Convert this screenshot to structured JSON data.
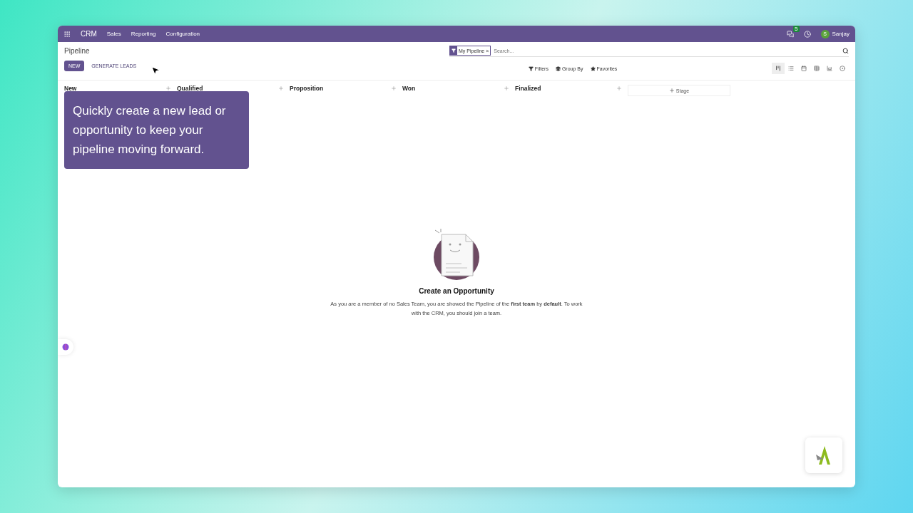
{
  "navbar": {
    "app": "CRM",
    "menus": [
      "Sales",
      "Reporting",
      "Configuration"
    ],
    "messages_badge": "5",
    "user_initial": "S",
    "user_name": "Sanjay"
  },
  "breadcrumb": "Pipeline",
  "buttons": [
    {
      "label": "NEW",
      "kind": "primary"
    },
    {
      "label": "GENERATE LEADS",
      "kind": "link"
    }
  ],
  "search": {
    "facet": "My Pipeline",
    "facet_remove": "×",
    "placeholder": "Search..."
  },
  "search_options": [
    "Filters",
    "Group By",
    "Favorites"
  ],
  "views": [
    {
      "kind": "kanban",
      "selected": true
    },
    {
      "kind": "list",
      "selected": false
    },
    {
      "kind": "calendar",
      "selected": false
    },
    {
      "kind": "pivot",
      "selected": false
    },
    {
      "kind": "graph",
      "selected": false
    },
    {
      "kind": "activity",
      "selected": false
    }
  ],
  "columns": [
    {
      "name": "New"
    },
    {
      "name": "Qualified"
    },
    {
      "name": "Proposition"
    },
    {
      "name": "Won"
    },
    {
      "name": "Finalized"
    }
  ],
  "add_stage": "Stage",
  "tooltip": "Quickly create a new lead or opportunity to keep your pipeline moving forward.",
  "empty_state": {
    "title": "Create an Opportunity",
    "text": "As you are a member of no Sales Team, you are showed the Pipeline of the **first team** by **default**. To work with the CRM, you should join a team."
  }
}
